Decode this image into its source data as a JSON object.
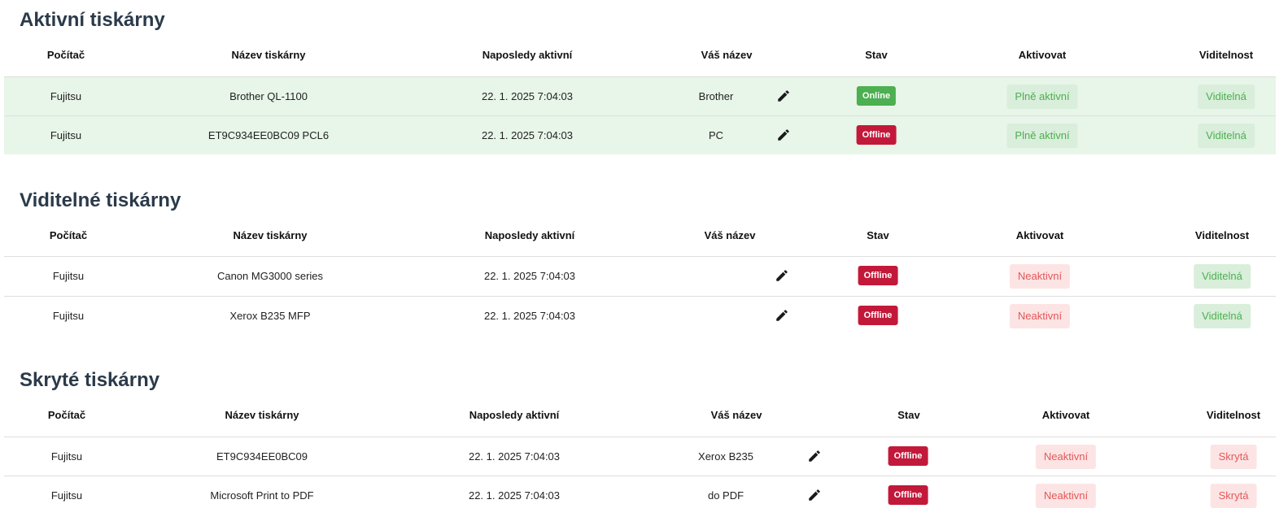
{
  "columns": {
    "computer": "Počítač",
    "printer_name": "Název tiskárny",
    "last_active": "Naposledy aktivní",
    "your_name": "Váš název",
    "status": "Stav",
    "activate": "Aktivovat",
    "visibility": "Viditelnost"
  },
  "icons": {
    "edit": "pencil-icon"
  },
  "colors": {
    "online": "#4caf50",
    "offline": "#c2193a",
    "active_row_bg": "#e8f5e9",
    "chip_green_bg": "#d9eedb",
    "chip_green_text": "#4caf50",
    "chip_red_bg": "#fde4e4",
    "chip_red_text": "#e2585a",
    "heading": "#2b3a4a"
  },
  "sections": [
    {
      "title": "Aktivní tiskárny",
      "rows": [
        {
          "computer": "Fujitsu",
          "printer_name": "Brother QL-1100",
          "last_active": "22. 1. 2025 7:04:03",
          "your_name": "Brother",
          "status": "Online",
          "activate": "Plně aktivní",
          "visibility": "Viditelná"
        },
        {
          "computer": "Fujitsu",
          "printer_name": "ET9C934EE0BC09 PCL6",
          "last_active": "22. 1. 2025 7:04:03",
          "your_name": "PC",
          "status": "Offline",
          "activate": "Plně aktivní",
          "visibility": "Viditelná"
        }
      ]
    },
    {
      "title": "Viditelné tiskárny",
      "rows": [
        {
          "computer": "Fujitsu",
          "printer_name": "Canon MG3000 series",
          "last_active": "22. 1. 2025 7:04:03",
          "your_name": "",
          "status": "Offline",
          "activate": "Neaktivní",
          "visibility": "Viditelná"
        },
        {
          "computer": "Fujitsu",
          "printer_name": "Xerox B235 MFP",
          "last_active": "22. 1. 2025 7:04:03",
          "your_name": "",
          "status": "Offline",
          "activate": "Neaktivní",
          "visibility": "Viditelná"
        }
      ]
    },
    {
      "title": "Skryté tiskárny",
      "rows": [
        {
          "computer": "Fujitsu",
          "printer_name": "ET9C934EE0BC09",
          "last_active": "22. 1. 2025 7:04:03",
          "your_name": "Xerox B235",
          "status": "Offline",
          "activate": "Neaktivní",
          "visibility": "Skrytá"
        },
        {
          "computer": "Fujitsu",
          "printer_name": "Microsoft Print to PDF",
          "last_active": "22. 1. 2025 7:04:03",
          "your_name": "do PDF",
          "status": "Offline",
          "activate": "Neaktivní",
          "visibility": "Skrytá"
        }
      ]
    }
  ]
}
